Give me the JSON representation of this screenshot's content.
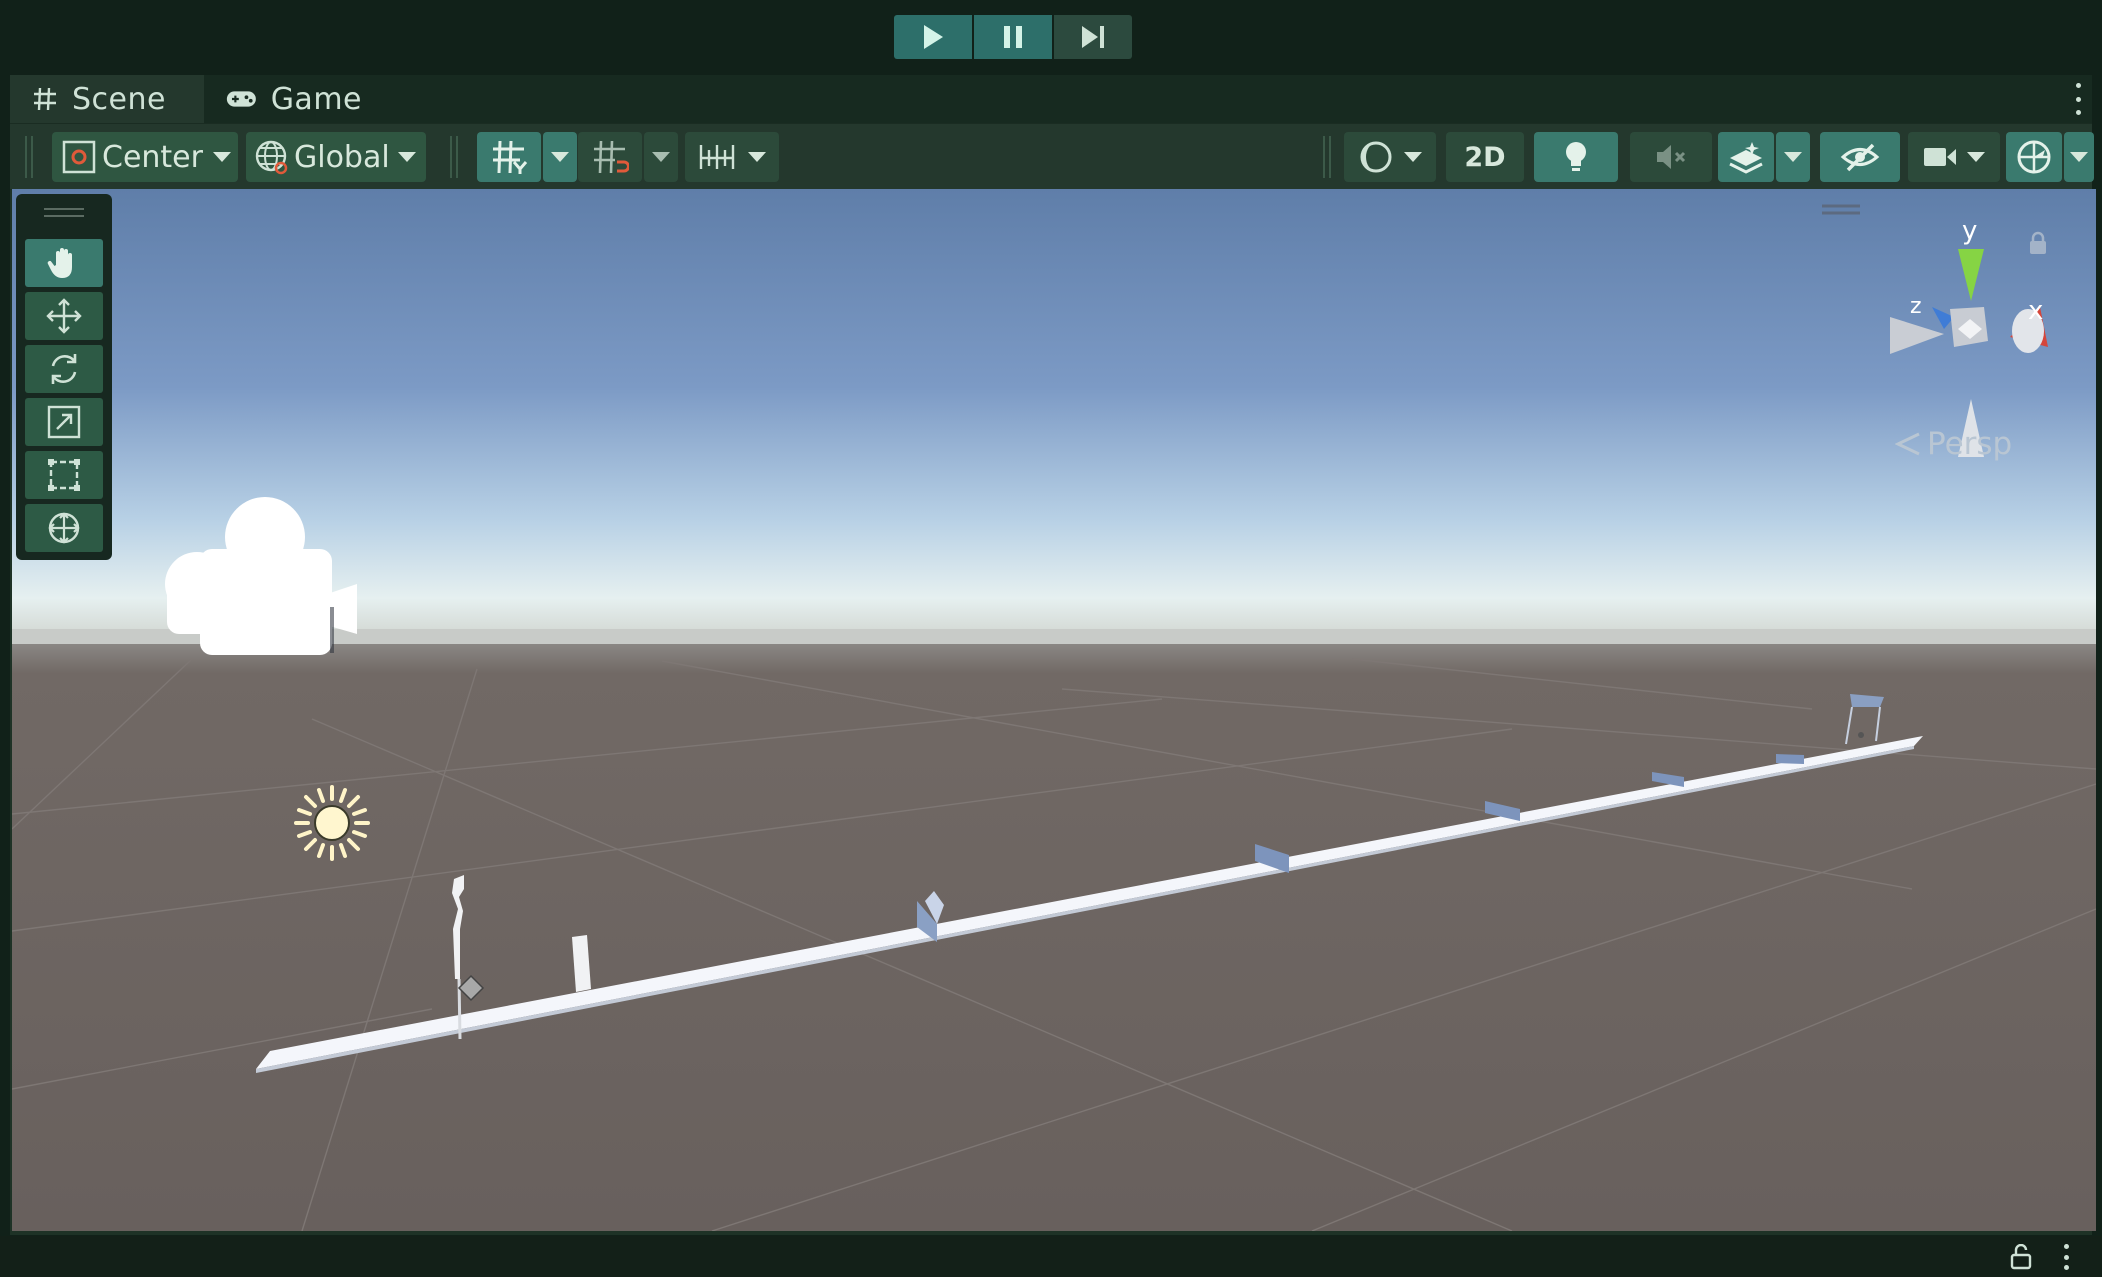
{
  "playbar": {
    "play": "play-icon",
    "pause": "pause-icon",
    "step": "step-forward-icon"
  },
  "tabs": [
    {
      "label": "Scene",
      "icon": "grid-hash-icon",
      "active": true
    },
    {
      "label": "Game",
      "icon": "gamepad-icon",
      "active": false
    }
  ],
  "toolbar": {
    "pivot": "Center",
    "space": "Global",
    "mode_2d": "2D"
  },
  "gizmo": {
    "axis_y": "y",
    "axis_x": "x",
    "axis_z": "z",
    "projection": "Persp"
  },
  "colors": {
    "accent": "#3a7a6e",
    "panel": "#1e3226",
    "sky_top": "#5f7ea9",
    "ground": "#6a625f",
    "axis_x": "#d5463b",
    "axis_y": "#86d444",
    "axis_z": "#3f7cd6"
  }
}
